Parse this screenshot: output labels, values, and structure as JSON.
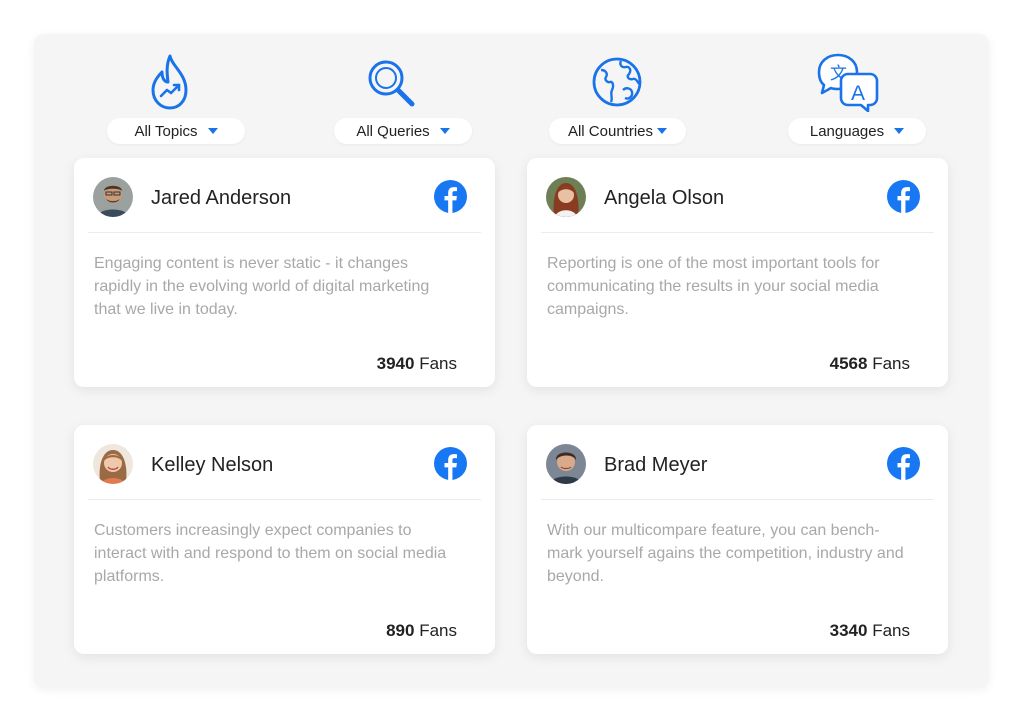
{
  "filters": [
    {
      "icon": "flame-trend-icon",
      "label": "All Topics"
    },
    {
      "icon": "search-icon",
      "label": "All Queries"
    },
    {
      "icon": "globe-icon",
      "label": "All Countries"
    },
    {
      "icon": "translate-icon",
      "label": "Languages"
    }
  ],
  "colors": {
    "accent": "#1a73e8",
    "facebook": "#1877f2"
  },
  "cards": [
    {
      "name": "Jared Anderson",
      "network": "facebook-icon",
      "text": "Engaging content is never static - it changes rapidly in the evolving world of digital marketing that we live in today.",
      "fans_count": "3940",
      "fans_label": "Fans"
    },
    {
      "name": "Angela Olson",
      "network": "facebook-icon",
      "text": "Reporting is one of the most important tools for communicating the results in your social media campaigns.",
      "fans_count": "4568",
      "fans_label": "Fans"
    },
    {
      "name": "Kelley Nelson",
      "network": "facebook-icon",
      "text": "Customers increasingly expect companies to interact with and respond to them on social media platforms.",
      "fans_count": "890",
      "fans_label": "Fans"
    },
    {
      "name": "Brad Meyer",
      "network": "facebook-icon",
      "text": "With our multicompare feature, you can bench-mark yourself agains the competition, industry and beyond.",
      "fans_count": "3340",
      "fans_label": "Fans"
    }
  ]
}
